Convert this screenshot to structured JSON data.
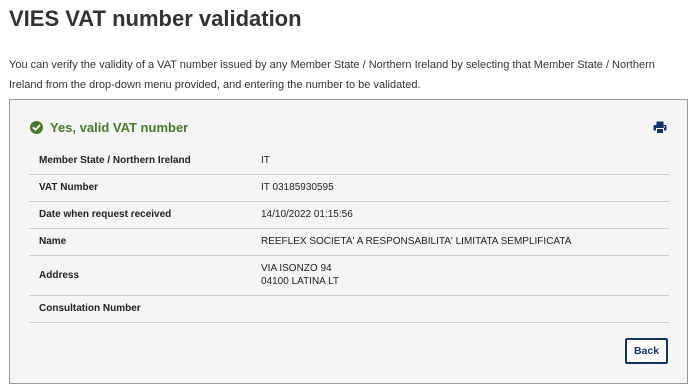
{
  "page": {
    "title": "VIES VAT number validation",
    "intro": "You can verify the validity of a VAT number issued by any Member State / Northern Ireland by selecting that Member State / Northern Ireland from the drop-down menu provided, and entering the number to be validated."
  },
  "result": {
    "status_text": "Yes, valid VAT number",
    "status_color": "#467b2a",
    "status_icon": "check-circle-icon",
    "print_icon": "print-icon",
    "rows": [
      {
        "label": "Member State / Northern Ireland",
        "value": "IT"
      },
      {
        "label": "VAT Number",
        "value": "IT 03185930595"
      },
      {
        "label": "Date when request received",
        "value": "14/10/2022 01:15:56"
      },
      {
        "label": "Name",
        "value": "REEFLEX SOCIETA' A RESPONSABILITA' LIMITATA SEMPLIFICATA"
      },
      {
        "label": "Address",
        "value_lines": [
          "VIA ISONZO 94",
          "04100 LATINA LT"
        ]
      },
      {
        "label": "Consultation Number",
        "value": ""
      }
    ]
  },
  "actions": {
    "back_label": "Back",
    "accent_color": "#12326e"
  }
}
